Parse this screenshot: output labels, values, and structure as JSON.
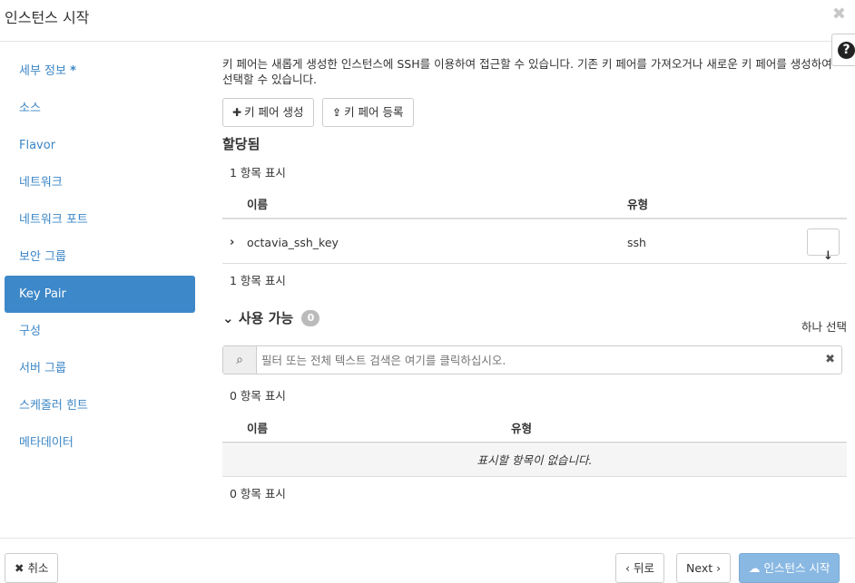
{
  "header": {
    "title": "인스턴스 시작",
    "close_icon": "✖"
  },
  "help": {
    "icon": "?"
  },
  "sidebar": {
    "items": [
      {
        "label": "세부 정보",
        "required": "*"
      },
      {
        "label": "소스"
      },
      {
        "label": "Flavor"
      },
      {
        "label": "네트워크"
      },
      {
        "label": "네트워크 포트"
      },
      {
        "label": "보안 그룹"
      },
      {
        "label": "Key Pair",
        "active": true
      },
      {
        "label": "구성"
      },
      {
        "label": "서버 그룹"
      },
      {
        "label": "스케줄러 힌트"
      },
      {
        "label": "메타데이터"
      }
    ]
  },
  "content": {
    "description": "키 페어는 새롭게 생성한 인스턴스에 SSH를 이용하여 접근할 수 있습니다. 기존 키 페어를 가져오거나 새로운 키 페어를 생성하여 선택할 수 있습니다.",
    "create_btn": "키 페어 생성",
    "import_btn": "키 페어 등록",
    "allocated": {
      "heading": "할당됨",
      "count_top": "1 항목 표시",
      "columns": [
        "이름",
        "유형"
      ],
      "rows": [
        {
          "name": "octavia_ssh_key",
          "type": "ssh"
        }
      ],
      "count_bottom": "1 항목 표시"
    },
    "available": {
      "heading": "사용 가능",
      "badge": "0",
      "select_hint": "하나 선택",
      "search_placeholder": "필터 또는 전체 텍스트 검색은 여기를 클릭하십시오.",
      "count_top": "0 항목 표시",
      "columns": [
        "이름",
        "유형"
      ],
      "empty_message": "표시할 항목이 없습니다.",
      "count_bottom": "0 항목 표시"
    }
  },
  "footer": {
    "cancel": "취소",
    "back": "뒤로",
    "next": "Next",
    "launch": "인스턴스 시작"
  },
  "colors": {
    "accent": "#3d88c9",
    "link": "#3b86c6",
    "primary_disabled": "#89b8e3"
  }
}
